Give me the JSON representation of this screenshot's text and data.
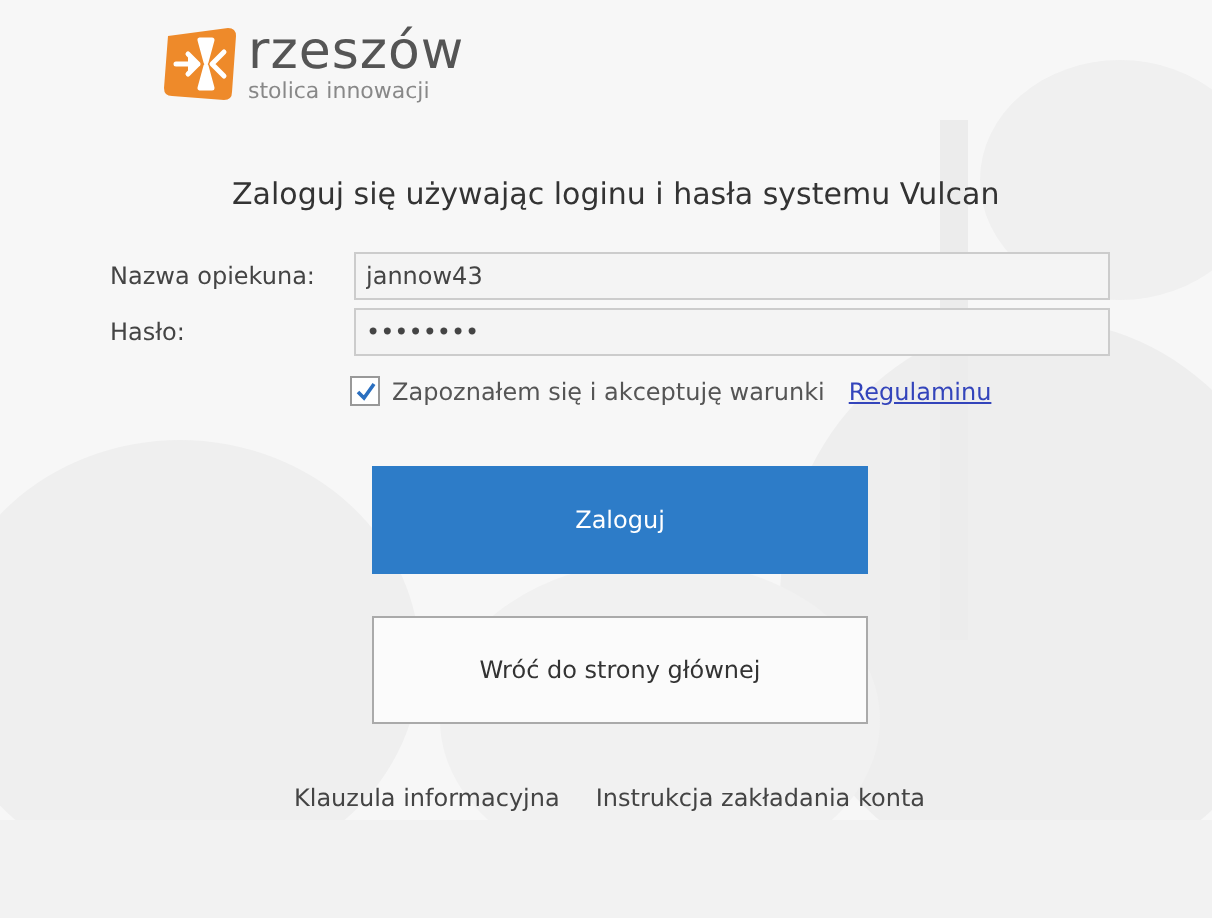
{
  "logo": {
    "name": "rzeszów",
    "tagline": "stolica innowacji"
  },
  "heading": "Zaloguj się używając loginu i hasła systemu Vulcan",
  "fields": [
    {
      "label": "Nazwa opiekuna:",
      "value": "jannow43"
    },
    {
      "label": "Hasło:",
      "value": "••••••••"
    }
  ],
  "terms": {
    "checked": true,
    "text": "Zapoznałem się i akceptuję warunki",
    "link": "Regulaminu"
  },
  "buttons": [
    {
      "label": "Zaloguj",
      "kind": "primary"
    },
    {
      "label": "Wróć do strony głównej",
      "kind": "secondary"
    }
  ],
  "footer_links": [
    "Klauzula informacyjna",
    "Instrukcja zakładania konta"
  ]
}
